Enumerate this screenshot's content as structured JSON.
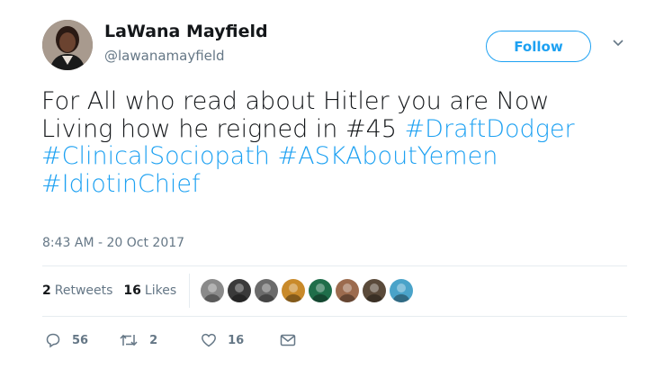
{
  "author": {
    "name": "LaWana Mayfield",
    "handle": "@lawanamayfield"
  },
  "follow_label": "Follow",
  "tweet": {
    "segments": [
      {
        "text": "For All who read about Hitler you are Now Living how he reigned in #45 ",
        "hashtag": false
      },
      {
        "text": "#DraftDodger",
        "hashtag": true
      },
      {
        "text": " ",
        "hashtag": false
      },
      {
        "text": "#ClinicalSociopath",
        "hashtag": true
      },
      {
        "text": " ",
        "hashtag": false
      },
      {
        "text": "#ASKAboutYemen",
        "hashtag": true
      },
      {
        "text": " ",
        "hashtag": false
      },
      {
        "text": "#IdiotinChief",
        "hashtag": true
      }
    ],
    "timestamp": "8:43 AM - 20 Oct 2017"
  },
  "stats": {
    "retweets_count": "2",
    "retweets_label": "Retweets",
    "likes_count": "16",
    "likes_label": "Likes"
  },
  "likers": [
    {
      "color": "#8a8a8a"
    },
    {
      "color": "#3a3a3a"
    },
    {
      "color": "#6b6b6b"
    },
    {
      "color": "#c98a2a"
    },
    {
      "color": "#1f6e4a"
    },
    {
      "color": "#9c6b4e"
    },
    {
      "color": "#5a4a3a"
    },
    {
      "color": "#4aa3c9"
    }
  ],
  "actions": {
    "replies": "56",
    "retweets": "2",
    "likes": "16"
  },
  "colors": {
    "accent": "#1da1f2",
    "text": "#14171a",
    "muted": "#657786"
  }
}
